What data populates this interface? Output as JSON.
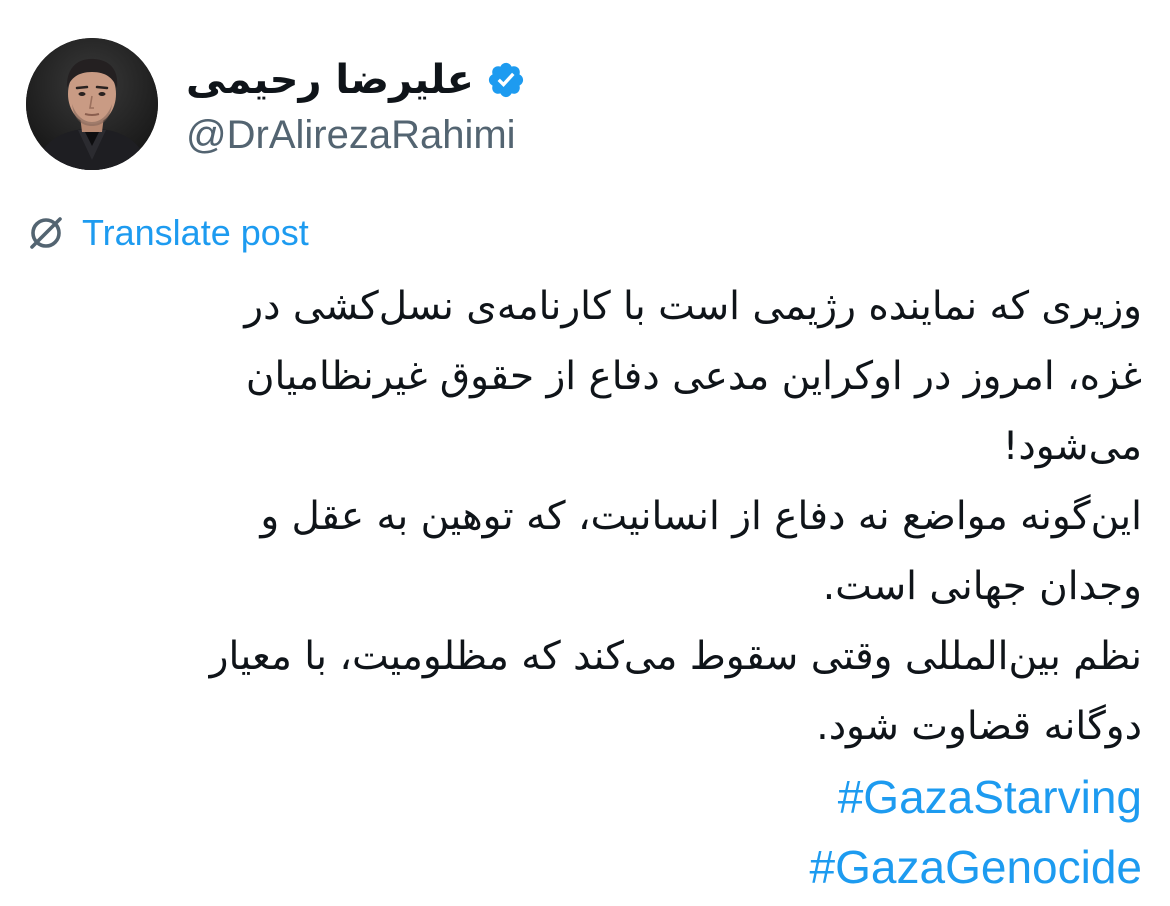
{
  "author": {
    "display_name": "علیرضا رحیمی",
    "handle": "@DrAlirezaRahimi",
    "verified_icon": "verified-badge-icon",
    "avatar_icon": "profile-photo"
  },
  "translate": {
    "label": "Translate post",
    "icon": "translate-icon"
  },
  "post": {
    "lines": [
      "وزیری که نماینده رژیمی است با کارنامه‌ی نسل‌کشی در",
      "غزه، امروز در اوکراین مدعی دفاع از حقوق غیرنظامیان",
      "می‌شود!",
      "این‌گونه مواضع نه دفاع از انسانیت، که توهین به عقل و",
      "وجدان جهانی است.",
      "نظم بین‌المللی وقتی سقوط می‌کند که مظلومیت، با معیار",
      "دوگانه قضاوت شود."
    ],
    "hashtags": [
      "#GazaStarving",
      "#GazaGenocide"
    ]
  },
  "colors": {
    "text": "#0f1419",
    "secondary": "#536471",
    "link": "#1d9bf0",
    "background": "#ffffff"
  }
}
